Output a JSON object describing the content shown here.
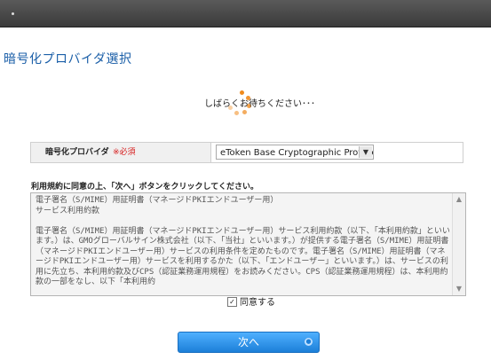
{
  "page": {
    "title": "暗号化プロバイダ選択",
    "loading_text": "しばらくお待ちください･･･"
  },
  "provider": {
    "label": "暗号化プロバイダ",
    "required": "※必須",
    "selected": "eToken Base Cryptographic Provider",
    "arrow_icon": "chevron-down-icon"
  },
  "terms": {
    "instruction": "利用規約に同意の上、「次へ」ボタンをクリックしてください。",
    "text": "電子署名（S/MIME）用証明書（マネージドPKIエンドユーザー用）\nサービス利用約款\n\n電子署名（S/MIME）用証明書（マネージドPKIエンドユーザー用）サービス利用約款（以下、「本利用約款」といいます。）は、GMOグローバルサイン株式会社（以下、「当社」といいます。）が提供する電子署名（S/MIME）用証明書（マネージドPKIエンドユーザー用）サービスの利用条件を定めたものです。電子署名（S/MIME）用証明書（マネージドPKIエンドユーザー用）サービスを利用するかた（以下、「エンドユーザー」といいます。）は、サービスの利用に先立ち、本利用約款及びCPS（認証業務運用規程）をお読みください。CPS（認証業務運用規程）は、本利用約款の一部をなし、以下「本利用約"
  },
  "agree": {
    "label": "同意する",
    "checked": true
  },
  "buttons": {
    "next": "次へ"
  },
  "colors": {
    "title": "#1b5fa8",
    "required": "#d61b1b",
    "spinner": "#f08a1c",
    "button": "#1c7fd8"
  }
}
